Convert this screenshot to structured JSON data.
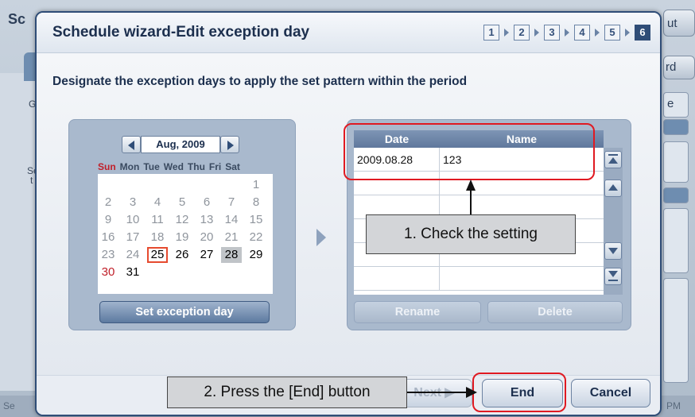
{
  "background": {
    "title": "Sc",
    "right_button": "ut",
    "right_button2": "rd",
    "left_letters": [
      "G",
      "Se",
      "t"
    ],
    "right_letter": "e",
    "footer_left": "Se",
    "footer_right": "PM"
  },
  "dialog": {
    "title": "Schedule wizard-Edit exception day",
    "steps": [
      "1",
      "2",
      "3",
      "4",
      "5",
      "6"
    ],
    "active_step": "6",
    "subtitle": "Designate the exception days to apply the set pattern within the period"
  },
  "calendar": {
    "month_label": "Aug, 2009",
    "weekdays": [
      "Sun",
      "Mon",
      "Tue",
      "Wed",
      "Thu",
      "Fri",
      "Sat"
    ],
    "weeks": [
      [
        "",
        "",
        "",
        "",
        "",
        "",
        "1"
      ],
      [
        "2",
        "3",
        "4",
        "5",
        "6",
        "7",
        "8"
      ],
      [
        "9",
        "10",
        "11",
        "12",
        "13",
        "14",
        "15"
      ],
      [
        "16",
        "17",
        "18",
        "19",
        "20",
        "21",
        "22"
      ],
      [
        "23",
        "24",
        "25",
        "26",
        "27",
        "28",
        "29"
      ],
      [
        "30",
        "31",
        "",
        "",
        "",
        "",
        ""
      ]
    ],
    "today": "25",
    "selected": "28",
    "set_button": "Set exception day"
  },
  "table": {
    "col_date": "Date",
    "col_name": "Name",
    "rows": [
      {
        "date": "2009.08.28",
        "name": "123"
      },
      {
        "date": "",
        "name": ""
      },
      {
        "date": "",
        "name": ""
      },
      {
        "date": "",
        "name": ""
      },
      {
        "date": "",
        "name": ""
      },
      {
        "date": "",
        "name": ""
      }
    ],
    "rename_button": "Rename",
    "delete_button": "Delete"
  },
  "footer": {
    "next_button": "Next",
    "end_button": "End",
    "cancel_button": "Cancel"
  },
  "annotations": {
    "callout1": "1. Check the setting",
    "callout2": "2. Press the [End] button"
  },
  "colors": {
    "highlight": "#e01a22",
    "dialog_border": "#2f4d77",
    "sunday": "#c0202a"
  }
}
